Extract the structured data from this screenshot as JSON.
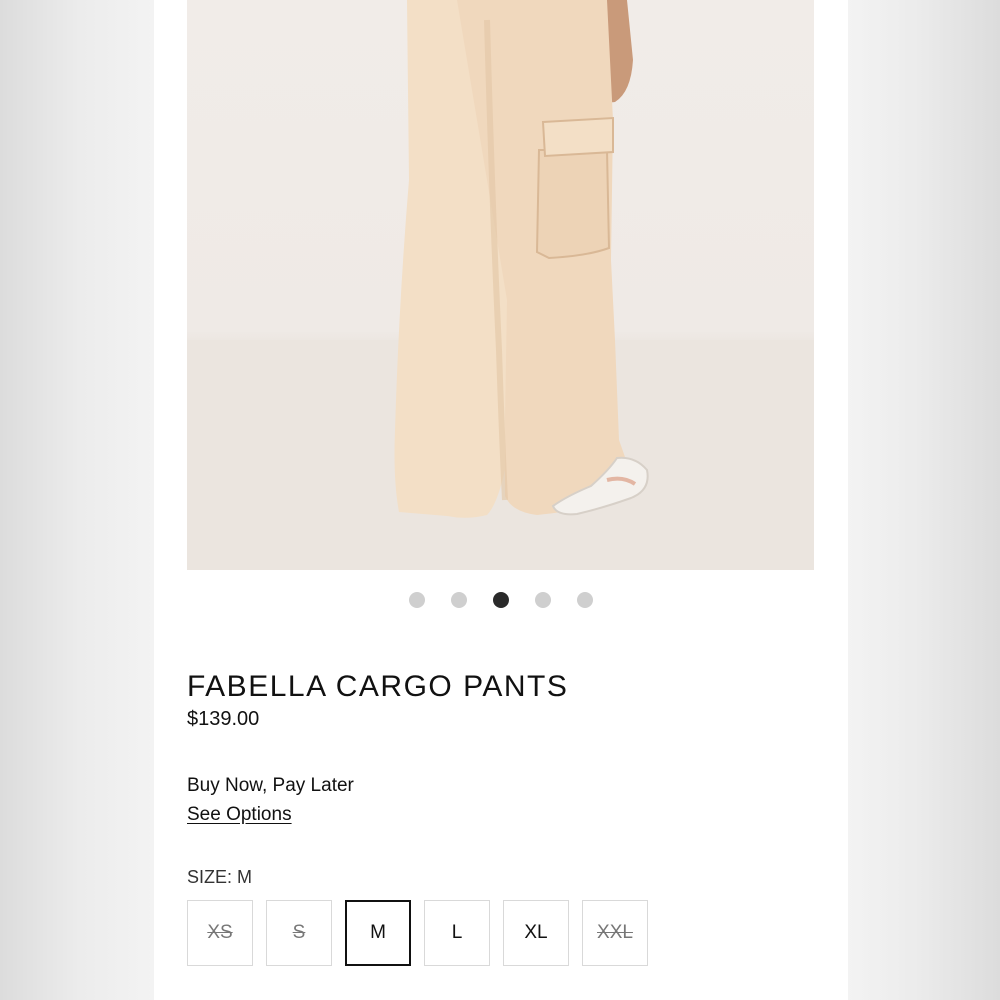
{
  "product": {
    "title": "FABELLA CARGO PANTS",
    "price": "$139.00",
    "image_description_alt": "Model wearing cream wide-leg cargo pants",
    "carousel": {
      "count": 5,
      "active_index": 2
    }
  },
  "payment": {
    "bnpl_text": "Buy Now, Pay Later",
    "see_options_label": "See Options"
  },
  "size": {
    "label": "SIZE: M",
    "options": [
      {
        "label": "XS",
        "available": false,
        "selected": false
      },
      {
        "label": "S",
        "available": false,
        "selected": false
      },
      {
        "label": "M",
        "available": true,
        "selected": true
      },
      {
        "label": "L",
        "available": true,
        "selected": false
      },
      {
        "label": "XL",
        "available": true,
        "selected": false
      },
      {
        "label": "XXL",
        "available": false,
        "selected": false
      }
    ]
  },
  "colors": {
    "pants": "#f1dcc3",
    "background": "#efeae6",
    "active_dot": "#2a2a2a",
    "inactive_dot": "#cfcfcf"
  }
}
